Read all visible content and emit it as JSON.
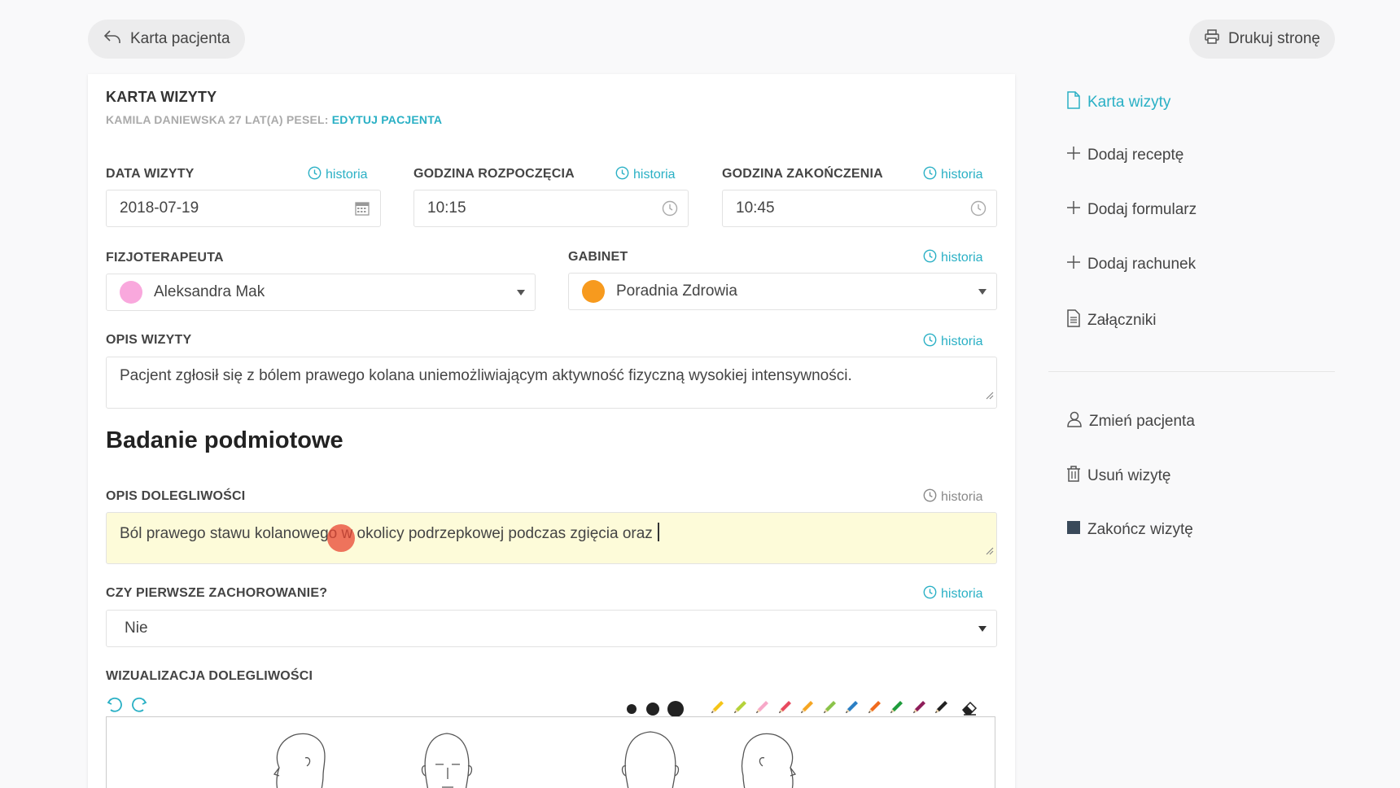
{
  "top": {
    "back_label": "Karta pacjenta",
    "print_label": "Drukuj stronę"
  },
  "card": {
    "title": "KARTA WIZYTY",
    "patient_info": "KAMILA DANIEWSKA 27 LAT(A) PESEL: ",
    "edit_patient": "EDYTUJ PACJENTA"
  },
  "fields": {
    "history_label": "historia",
    "date_label": "DATA WIZYTY",
    "date_value": "2018-07-19",
    "start_label": "GODZINA ROZPOCZĘCIA",
    "start_value": "10:15",
    "end_label": "GODZINA ZAKOŃCZENIA",
    "end_value": "10:45",
    "therapist_label": "FIZJOTERAPEUTA",
    "therapist_value": "Aleksandra Mak",
    "therapist_color": "#f9a8dd",
    "office_label": "GABINET",
    "office_value": "Poradnia Zdrowia",
    "office_color": "#f79a1e",
    "desc_label": "OPIS WIZYTY",
    "desc_value": "Pacjent zgłosił się z bólem prawego kolana uniemożliwiającym aktywność fizyczną wysokiej intensywności.",
    "section_title": "Badanie podmiotowe",
    "complaint_label": "OPIS DOLEGLIWOŚCI",
    "complaint_value": "Ból prawego stawu kolanowego w okolicy podrzepkowej podczas zgięcia oraz",
    "first_label": "CZY PIERWSZE ZACHOROWANIE?",
    "first_value": "Nie",
    "viz_label": "WIZUALIZACJA DOLEGLIWOŚCI"
  },
  "palette": {
    "pencil_colors": [
      "#f5c518",
      "#b5d23a",
      "#f7a8c8",
      "#e84a5f",
      "#f5a623",
      "#8bc34a",
      "#2b7fc4",
      "#f06a1d",
      "#1e9c3c",
      "#8e1e5a",
      "#222222"
    ]
  },
  "sidebar": {
    "visit_card": "Karta wizyty",
    "add_prescription": "Dodaj receptę",
    "add_form": "Dodaj formularz",
    "add_bill": "Dodaj rachunek",
    "attachments": "Załączniki",
    "change_patient": "Zmień pacjenta",
    "delete_visit": "Usuń wizytę",
    "finish_visit": "Zakończ wizytę"
  },
  "colors": {
    "accent": "#2ab0c5"
  }
}
